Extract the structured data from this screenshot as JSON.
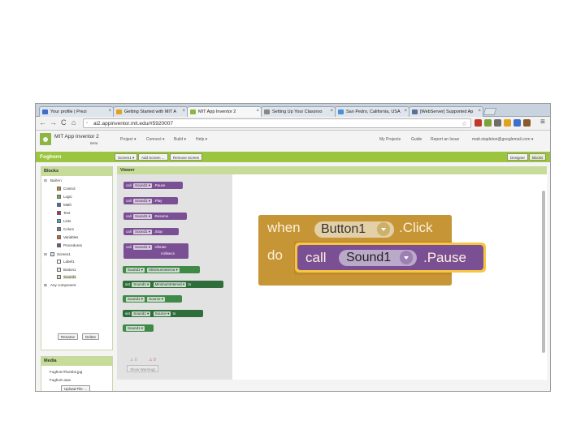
{
  "browser": {
    "tabs": [
      {
        "label": "Your profile | Prezi",
        "color": "#3a6fcf",
        "active": false
      },
      {
        "label": "Getting Started with MIT A",
        "color": "#e0a21f",
        "active": false
      },
      {
        "label": "MIT App Inventor 2",
        "color": "#8db640",
        "active": true
      },
      {
        "label": "Setting Up Your Classroo",
        "color": "#888888",
        "active": false
      },
      {
        "label": "San Pedro, California, USA",
        "color": "#4a90d9",
        "active": false
      },
      {
        "label": "[WebServer] Supported Ap",
        "color": "#5a6e9a",
        "active": false
      }
    ],
    "url": "ai2.appinventor.mit.edu/#5920007",
    "nav": {
      "back": "←",
      "forward": "→",
      "reload": "C",
      "home": "⌂"
    },
    "menu_icon": "≡"
  },
  "app": {
    "title": "MIT App Inventor 2",
    "beta": "Beta",
    "menus": [
      "Project ▾",
      "Connect ▾",
      "Build ▾",
      "Help ▾"
    ],
    "right_links": [
      "My Projects",
      "Guide",
      "Report an Issue",
      "matt.stapleton@googlemail.com ▾"
    ],
    "project_name": "Foghorn",
    "screen_buttons": [
      "Screen1 ▾",
      "Add Screen ...",
      "Remove Screen"
    ],
    "mode_buttons": [
      "Designer",
      "Blocks"
    ]
  },
  "blocks_panel": {
    "title": "Blocks",
    "builtin_label": "Built-in",
    "builtin": [
      {
        "label": "Control",
        "color": "#c88330"
      },
      {
        "label": "Logic",
        "color": "#77ab41"
      },
      {
        "label": "Math",
        "color": "#3f71b5"
      },
      {
        "label": "Text",
        "color": "#b32d5e"
      },
      {
        "label": "Lists",
        "color": "#49a6d4"
      },
      {
        "label": "Colors",
        "color": "#7d7d7d"
      },
      {
        "label": "Variables",
        "color": "#d05f2d"
      },
      {
        "label": "Procedures",
        "color": "#7b4f94"
      }
    ],
    "screen_label": "Screen1",
    "components": [
      "Label1",
      "Button1",
      "Sound1"
    ],
    "any_component": "Any component",
    "rename": "Rename",
    "delete": "Delete"
  },
  "media_panel": {
    "title": "Media",
    "items": [
      "FoghornThumbs.jpg",
      "Foghorn.wav"
    ],
    "upload": "Upload File ..."
  },
  "viewer": {
    "title": "Viewer",
    "drawer_blocks": [
      {
        "parts": [
          "call",
          "Sound1 ▾",
          ".Pause"
        ],
        "kind": "purple"
      },
      {
        "parts": [
          "call",
          "Sound1 ▾",
          ".Play"
        ],
        "kind": "purple"
      },
      {
        "parts": [
          "call",
          "Sound1 ▾",
          ".Resume"
        ],
        "kind": "purple"
      },
      {
        "parts": [
          "call",
          "Sound1 ▾",
          ".Stop"
        ],
        "kind": "purple"
      },
      {
        "parts": [
          "call",
          "Sound1 ▾",
          ".Vibrate",
          "millisecs"
        ],
        "kind": "purple"
      },
      {
        "parts": [
          "Sound1 ▾",
          "MinimumInterva ▾"
        ],
        "kind": "lgreen"
      },
      {
        "parts": [
          "set",
          "Sound1 ▾",
          "MinimumInterval ▾",
          "to"
        ],
        "kind": "green"
      },
      {
        "parts": [
          "Sound1 ▾",
          "Source ▾"
        ],
        "kind": "lgreen"
      },
      {
        "parts": [
          "set",
          "Sound1 ▾",
          "Source ▾",
          "to"
        ],
        "kind": "green"
      },
      {
        "parts": [
          "Sound1 ▾"
        ],
        "kind": "lgreen"
      }
    ],
    "event_block": {
      "when": "when",
      "component": "Button1",
      "event": ".Click",
      "do": "do"
    },
    "call_block": {
      "call": "call",
      "component": "Sound1",
      "method": ".Pause"
    },
    "warnings": {
      "warning_count": "0",
      "error_count": "0",
      "show_button": "Show Warnings"
    }
  }
}
